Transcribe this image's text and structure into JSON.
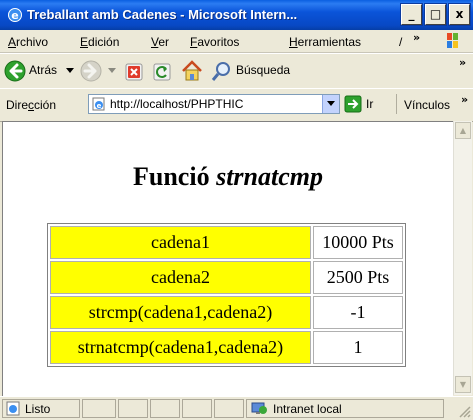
{
  "window": {
    "title": "Treballant amb Cadenes - Microsoft Intern...",
    "minimize": "_",
    "maximize": "□",
    "close": "x"
  },
  "menubar": {
    "items": [
      {
        "accel": "A",
        "rest": "rchivo"
      },
      {
        "accel": "E",
        "rest": "dición"
      },
      {
        "accel": "V",
        "rest": "er"
      },
      {
        "accel": "F",
        "rest": "avoritos"
      },
      {
        "accel": "H",
        "rest": "erramientas"
      },
      {
        "accel": "",
        "rest": "/"
      }
    ],
    "overflow": "»"
  },
  "toolbar": {
    "back_label": "Atrás",
    "search_label": "Búsqueda",
    "overflow": "»"
  },
  "addressbar": {
    "label_pre": "Dire",
    "label_accel": "c",
    "label_post": "ción",
    "url": "http://localhost/PHPTHIC",
    "go_label": "Ir",
    "links_label": "Vínculos",
    "overflow": "»"
  },
  "page": {
    "heading_plain": "Funció",
    "heading_italic": "strnatcmp",
    "rows": [
      {
        "key": "cadena1",
        "value": "10000 Pts"
      },
      {
        "key": "cadena2",
        "value": "2500 Pts"
      },
      {
        "key": "strcmp(cadena1,cadena2)",
        "value": "-1"
      },
      {
        "key": "strnatcmp(cadena1,cadena2)",
        "value": "1"
      }
    ],
    "key_color": "#ffff00"
  },
  "statusbar": {
    "status": "Listo",
    "zone": "Intranet local"
  }
}
